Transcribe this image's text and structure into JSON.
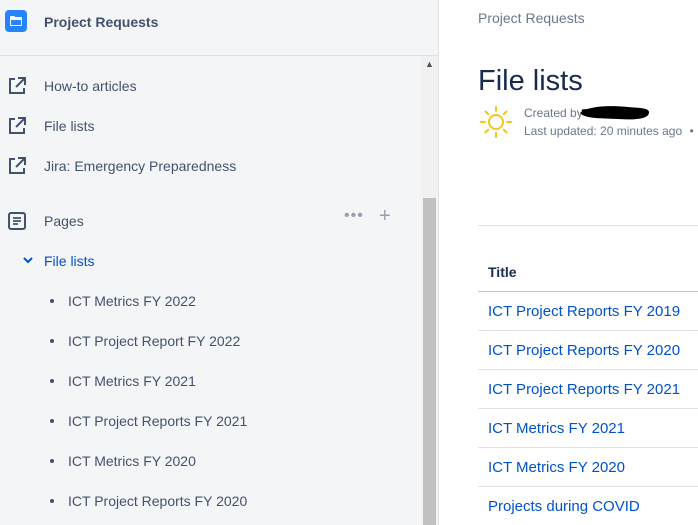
{
  "sidebar": {
    "space_title": "Project Requests",
    "shortcuts": [
      {
        "label": "How-to articles",
        "icon": "external-link-icon"
      },
      {
        "label": "File lists",
        "icon": "external-link-icon"
      },
      {
        "label": "Jira: Emergency Preparedness",
        "icon": "external-link-icon"
      }
    ],
    "pages_label": "Pages",
    "pages_more": "•••",
    "pages_add": "+",
    "tree": {
      "parent": "File lists",
      "children": [
        "ICT Metrics FY 2022",
        "ICT Project Report FY 2022",
        "ICT Metrics FY 2021",
        "ICT Project Reports FY 2021",
        "ICT Metrics FY 2020",
        "ICT Project Reports FY 2020"
      ]
    }
  },
  "main": {
    "breadcrumb": "Project Requests",
    "title": "File lists",
    "byline": {
      "created_prefix": "Created by",
      "last_updated": "Last updated: 20 minutes ago",
      "separator": "•"
    },
    "table": {
      "header": "Title",
      "rows": [
        "ICT Project Reports FY 2019",
        "ICT Project Reports FY 2020",
        "ICT Project Reports FY 2021",
        "ICT Metrics FY 2021",
        "ICT Metrics FY 2020",
        "Projects during COVID"
      ]
    }
  },
  "colors": {
    "accent": "#0052cc",
    "sidebar_bg": "#f4f5f7",
    "space_icon": "#2684ff",
    "text_muted": "#42526e"
  }
}
